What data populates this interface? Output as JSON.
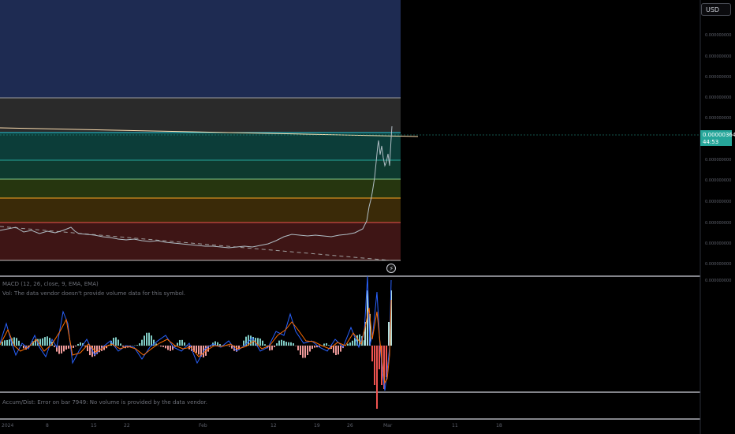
{
  "price_scale": {
    "currency_label": "USD",
    "current_price": "0.00000364",
    "countdown": "44:53",
    "tick_labels": [
      "0.000000000",
      "0.000000000",
      "0.000000000",
      "0.000000000",
      "0.000000000",
      "0.000000000",
      "0.000000000",
      "0.000000000",
      "0.000000000",
      "0.000000000",
      "0.000000000",
      "0.000000000"
    ]
  },
  "indicators": {
    "macd_title": "MACD (12, 26, close, 9, EMA, EMA)",
    "data_vendor_note": "Vol: The data vendor doesn't provide volume data for this symbol.",
    "volume_error": "Accum/Dist: Error on bar 7949: No volume is provided by the data vendor."
  },
  "time_axis": {
    "labels": [
      "2024",
      "8",
      "15",
      "22",
      "Feb",
      "12",
      "19",
      "26",
      "Mar",
      "11",
      "18"
    ]
  },
  "colors": {
    "background": "#000000",
    "up": "#26a69a",
    "down": "#ef5350",
    "macd_line": "#2962ff",
    "signal_line": "#ff6d00"
  },
  "chart_data": {
    "type": "line",
    "title": "",
    "xlabel": "",
    "ylabel": "",
    "fib_zones": [
      {
        "color": "#1e2b52"
      },
      {
        "color": "#2a2a2a"
      },
      {
        "color": "#0c3d39"
      },
      {
        "color": "#0e3a2f"
      },
      {
        "color": "#26360f"
      },
      {
        "color": "#3a2a08"
      },
      {
        "color": "#3e1515"
      }
    ],
    "grid": false,
    "legend": "none"
  }
}
